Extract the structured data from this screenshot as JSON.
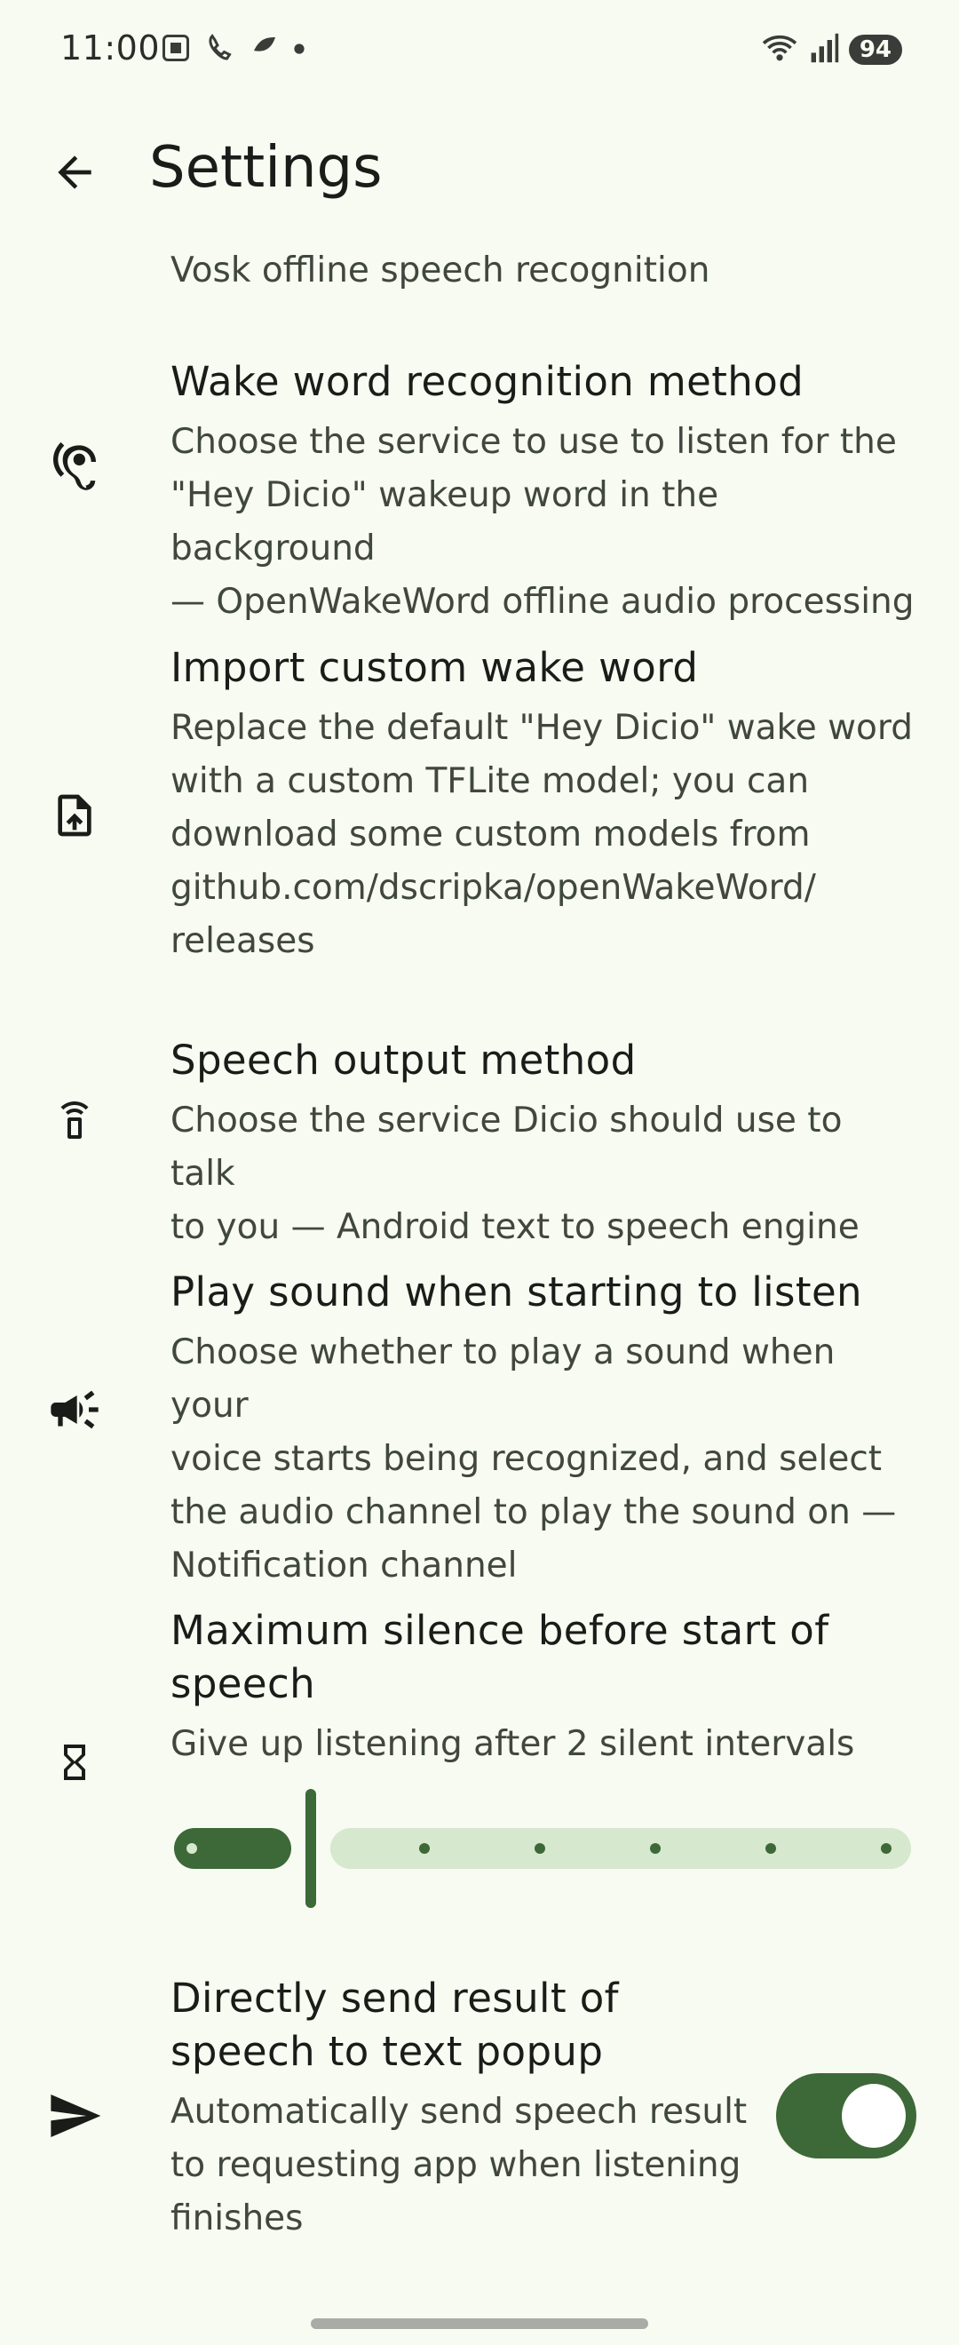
{
  "status_bar": {
    "time": "11:00",
    "battery": "94",
    "icons_left": [
      "screenshot-icon",
      "wifi-call-icon",
      "app-icon",
      "dot-icon"
    ],
    "icons_right": [
      "wifi-icon",
      "signal-icon",
      "battery-icon"
    ]
  },
  "app_bar": {
    "title": "Settings",
    "back_icon": "arrow-back-icon"
  },
  "partial_item": {
    "description": "Vosk offline speech recognition"
  },
  "items": [
    {
      "icon": "hearing-icon",
      "title": "Wake word recognition method",
      "description_lines": [
        "Choose the service to use to listen for the",
        "\"Hey Dicio\" wakeup word in the background",
        "— OpenWakeWord offline audio processing"
      ]
    },
    {
      "icon": "file-upload-icon",
      "title": "Import custom wake word",
      "description_lines": [
        "Replace the default \"Hey Dicio\" wake word",
        "with a custom TFLite model; you can",
        "download some custom models from",
        "github.com/dscripka/openWakeWord/",
        "releases"
      ]
    },
    {
      "icon": "speaker-phone-icon",
      "title": "Speech output method",
      "description_lines": [
        "Choose the service Dicio should use to talk",
        "to you — Android text to speech engine"
      ]
    },
    {
      "icon": "campaign-icon",
      "title": "Play sound when starting to listen",
      "description_lines": [
        "Choose whether to play a sound when your",
        "voice starts being recognized, and select",
        "the audio channel to play the sound on —",
        "Notification channel"
      ]
    },
    {
      "icon": "hourglass-icon",
      "title_lines": [
        "Maximum silence before start of",
        "speech"
      ],
      "description_lines": [
        "Give up listening after 2 silent intervals"
      ],
      "slider": {
        "value": 2,
        "min": 1,
        "max": 8
      }
    },
    {
      "icon": "send-icon",
      "title_lines": [
        "Directly send result of",
        "speech to text popup"
      ],
      "description_lines": [
        "Automatically send speech result",
        "to requesting app when listening",
        "finishes"
      ],
      "toggle_on": true
    }
  ],
  "colors": {
    "background": "#f7fbf1",
    "accent": "#3d6837",
    "accent_light": "#d6e8cd"
  }
}
